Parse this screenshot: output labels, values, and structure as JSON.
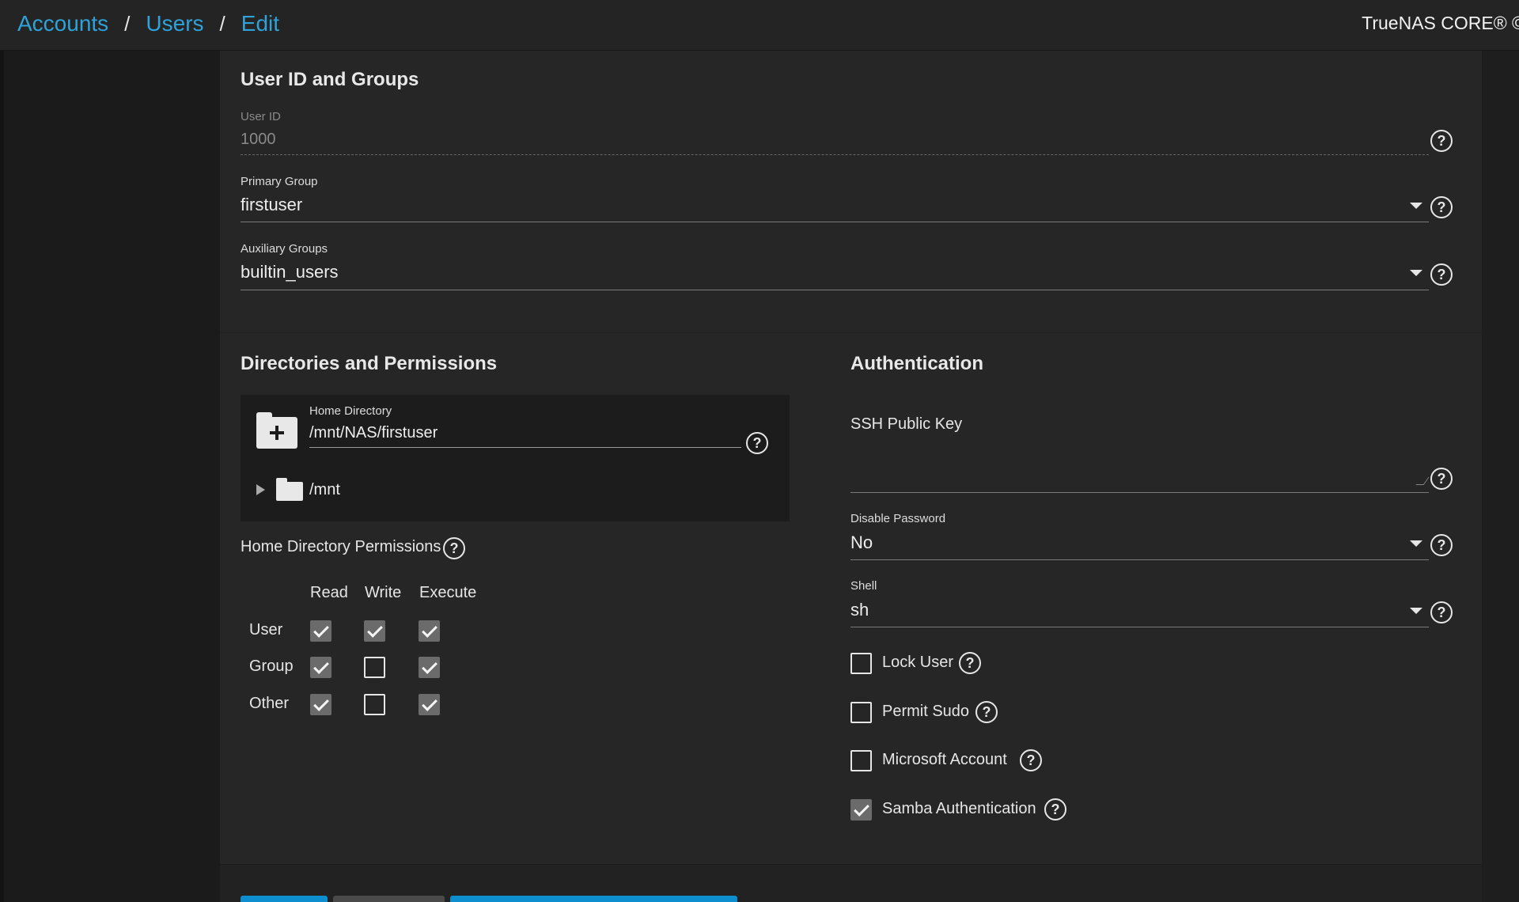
{
  "breadcrumb": {
    "accounts": "Accounts",
    "users": "Users",
    "edit": "Edit",
    "separator": "/"
  },
  "product": "TrueNAS CORE® ©",
  "user_id_groups": {
    "title": "User ID and Groups",
    "user_id": {
      "label": "User ID",
      "value": "1000"
    },
    "primary_group": {
      "label": "Primary Group",
      "value": "firstuser"
    },
    "auxiliary_groups": {
      "label": "Auxiliary Groups",
      "value": "builtin_users"
    }
  },
  "directories": {
    "title": "Directories and Permissions",
    "home_directory": {
      "label": "Home Directory",
      "value": "/mnt/NAS/firstuser"
    },
    "tree_root": "/mnt",
    "permissions_label": "Home Directory Permissions",
    "columns": [
      "Read",
      "Write",
      "Execute"
    ],
    "rows": [
      {
        "label": "User",
        "read": true,
        "write": true,
        "execute": true
      },
      {
        "label": "Group",
        "read": true,
        "write": false,
        "execute": true
      },
      {
        "label": "Other",
        "read": true,
        "write": false,
        "execute": true
      }
    ]
  },
  "authentication": {
    "title": "Authentication",
    "ssh_key": {
      "label": "SSH Public Key",
      "value": ""
    },
    "disable_password": {
      "label": "Disable Password",
      "value": "No"
    },
    "shell": {
      "label": "Shell",
      "value": "sh"
    },
    "lock_user": {
      "label": "Lock User",
      "checked": false
    },
    "permit_sudo": {
      "label": "Permit Sudo",
      "checked": false
    },
    "microsoft_account": {
      "label": "Microsoft Account",
      "checked": false
    },
    "samba_auth": {
      "label": "Samba Authentication",
      "checked": true
    }
  },
  "colors": {
    "accent": "#2ea2d9",
    "background": "#1e1e1e",
    "card": "#262626",
    "checkbox_checked": "#6b6b6b"
  },
  "icons": {
    "help": "help-circle-icon",
    "dropdown": "caret-down-icon",
    "folder_add": "folder-plus-icon",
    "folder": "folder-icon"
  }
}
